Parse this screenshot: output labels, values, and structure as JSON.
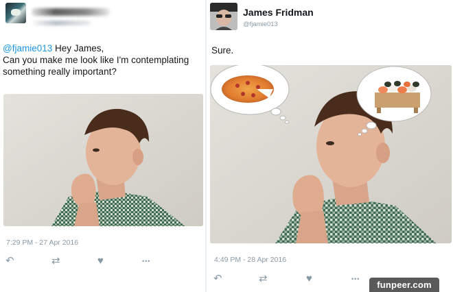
{
  "left_tweet": {
    "mention": "@fjamie013",
    "line1_rest": " Hey James,",
    "line2": "Can you make me look like I'm contemplating",
    "line3": "something really important?",
    "timestamp": "7:29 PM - 27 Apr 2016"
  },
  "right_tweet": {
    "author_name": "James Fridman",
    "author_handle": "@fjamie013",
    "text": "Sure.",
    "timestamp": "4:49 PM - 28 Apr 2016"
  },
  "icons": {
    "reply": "reply-icon",
    "retweet": "retweet-icon",
    "like": "heart-icon",
    "more": "more-icon"
  },
  "glyphs": {
    "reply": "↶",
    "retweet": "⇄",
    "like": "♥",
    "more": "•••"
  },
  "watermark": "funpeer.com",
  "colors": {
    "mention": "#1b95e0",
    "meta": "#8899a6",
    "text": "#14171a"
  }
}
